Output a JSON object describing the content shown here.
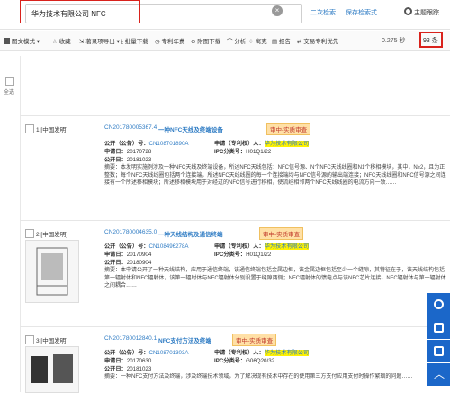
{
  "search": {
    "query": "华为技术有限公司 NFC",
    "second_search_label": "二次检索",
    "save_label": "保存检索式",
    "topic_label": "主题跟踪"
  },
  "toolbar": {
    "items": [
      "图文模式",
      "收藏",
      "著录项导出",
      "批量下载",
      "专利年费",
      "附图下载",
      "分析",
      "寓克",
      "报告",
      "交易专利优先"
    ],
    "count_text": "0.275 秒",
    "page_text": "93 条"
  },
  "left": {
    "select_all": "全选"
  },
  "records": [
    {
      "index": "1 [中国发明]",
      "pub_no": "CN201780005367.4",
      "title": "一种NFC天线及终端设备",
      "badge": "审中-实质审查",
      "pub_label": "公开（公告）号：",
      "pub_value": "CN108701890A",
      "applicant_label": "申请（专利权）人：",
      "applicant_value": "华为技术有限公司",
      "appdate_label": "申请日：",
      "appdate_value": "20170728",
      "ipc_label": "IPC分类号：",
      "ipc_value": "H01Q1/22",
      "pubdate_label": "公开日：",
      "pubdate_value": "20181023",
      "abstract": "摘要：本发明实施例涉及一种NFC天线及终端设备，所述NFC天线包括：NFC信号源、N个NFC天线线圈和N1个移相模块，其中，N≥2，且为正整数；每个NFC天线线圈包括两个连接端，所述NFC天线线圈的每一个连接端均与NFC信号源的输出端连接；NFC天线线圈和NFC信号源之间连接有一个所述移相模块；所述移相模块用于对经过的NFC信号进行移相，使流经相邻两个NFC天线线圈的电流方向一致……"
    },
    {
      "index": "2 [中国发明]",
      "pub_no": "CN201780004635.0",
      "title": "一种天线结构及通信终端",
      "badge": "审中-实质审查",
      "pub_label": "公开（公告）号：",
      "pub_value": "CN108496278A",
      "applicant_label": "申请（专利权）人：",
      "applicant_value": "华为技术有限公司",
      "appdate_label": "申请日：",
      "appdate_value": "20170904",
      "ipc_label": "IPC分类号：",
      "ipc_value": "H01Q1/22",
      "pubdate_label": "公开日：",
      "pubdate_value": "20180904",
      "abstract": "摘要：本申请公开了一种天线结构，应用于通信终端，该通信终端包括金属边框，该金属边框包括至少一个缝隙，其特征在于，该天线结构包括第一辐射体和NFC辐射体，该第一辐射体与NFC辐射体分别设置于缝隙两侧；NFC辐射体的馈电点与该NFC芯片连接，NFC辐射体与第一辐射体之间耦合……"
    },
    {
      "index": "3 [中国发明]",
      "pub_no": "CN201780012840.1",
      "title": "NFC支付方法及终端",
      "badge": "审中-实质审查",
      "pub_label": "公开（公告）号：",
      "pub_value": "CN108701303A",
      "applicant_label": "申请（专利权）人：",
      "applicant_value": "华为技术有限公司",
      "appdate_label": "申请日：",
      "appdate_value": "20170630",
      "ipc_label": "IPC分类号：",
      "ipc_value": "G06Q20/32",
      "pubdate_label": "公开日：",
      "pubdate_value": "20181023",
      "abstract": "摘要：一种NFC支付方法及终端，涉及终端技术领域，为了解决现有技术中存在的使用第三方支付应用支付时操作繁琐的问题……"
    }
  ]
}
